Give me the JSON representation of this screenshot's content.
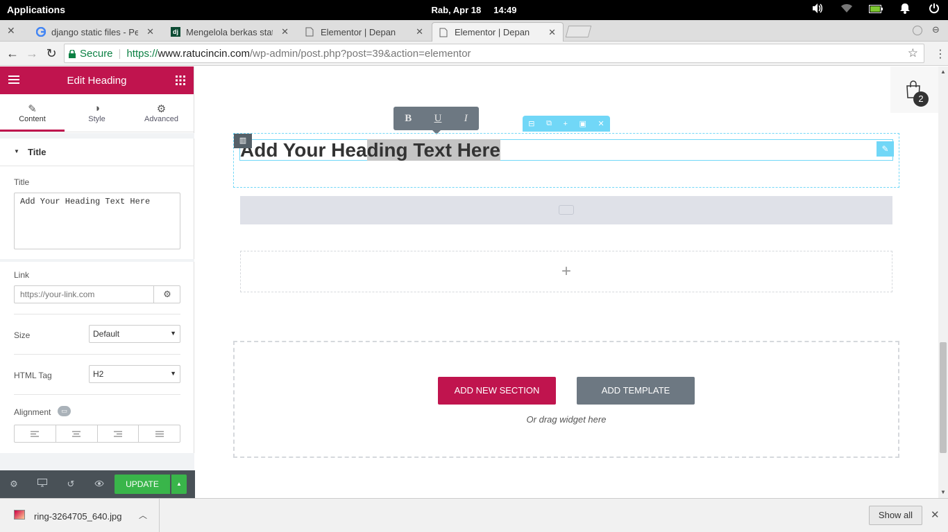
{
  "system_bar": {
    "apps_label": "Applications",
    "datetime": "Rab, Apr 18     14:49",
    "tray_icons": [
      "volume-icon",
      "wifi-icon",
      "battery-icon",
      "notification-icon",
      "power-icon"
    ]
  },
  "browser": {
    "tabs": [
      {
        "title": "django static files - Pen",
        "favicon": "google-icon"
      },
      {
        "title": "Mengelola berkas statis",
        "favicon": "django-icon"
      },
      {
        "title": "Elementor | Depan",
        "favicon": "page-icon"
      },
      {
        "title": "Elementor | Depan",
        "favicon": "page-icon",
        "active": true
      }
    ],
    "secure_label": "Secure",
    "url_scheme": "https://",
    "url_host": "www.ratucincin.com",
    "url_path": "/wp-admin/post.php?post=39&action=elementor"
  },
  "panel": {
    "header_title": "Edit Heading",
    "tabs": [
      {
        "label": "Content",
        "icon": "pencil-icon",
        "active": true
      },
      {
        "label": "Style",
        "icon": "contrast-icon"
      },
      {
        "label": "Advanced",
        "icon": "gear-icon"
      }
    ],
    "section_title": "Title",
    "title_label": "Title",
    "title_value": "Add Your Heading Text Here",
    "link_label": "Link",
    "link_placeholder": "https://your-link.com",
    "size_label": "Size",
    "size_value": "Default",
    "html_tag_label": "HTML Tag",
    "html_tag_value": "H2",
    "alignment_label": "Alignment",
    "footer": {
      "update_label": "UPDATE"
    }
  },
  "canvas": {
    "heading_before": "Add Your Hea",
    "heading_selected": "ding Text Here",
    "inline_toolbar": {
      "bold": "B",
      "underline": "U",
      "italic": "I"
    },
    "cart_count": "2",
    "add_section_label": "ADD NEW SECTION",
    "add_template_label": "ADD TEMPLATE",
    "drag_hint": "Or drag widget here",
    "plus_label": "+"
  },
  "download_bar": {
    "filename": "ring-3264705_640.jpg",
    "show_all_label": "Show all"
  },
  "colors": {
    "brand": "#c0144e",
    "update_green": "#39b54a",
    "handle_blue": "#71d7f7",
    "template_gray": "#6d7882"
  }
}
